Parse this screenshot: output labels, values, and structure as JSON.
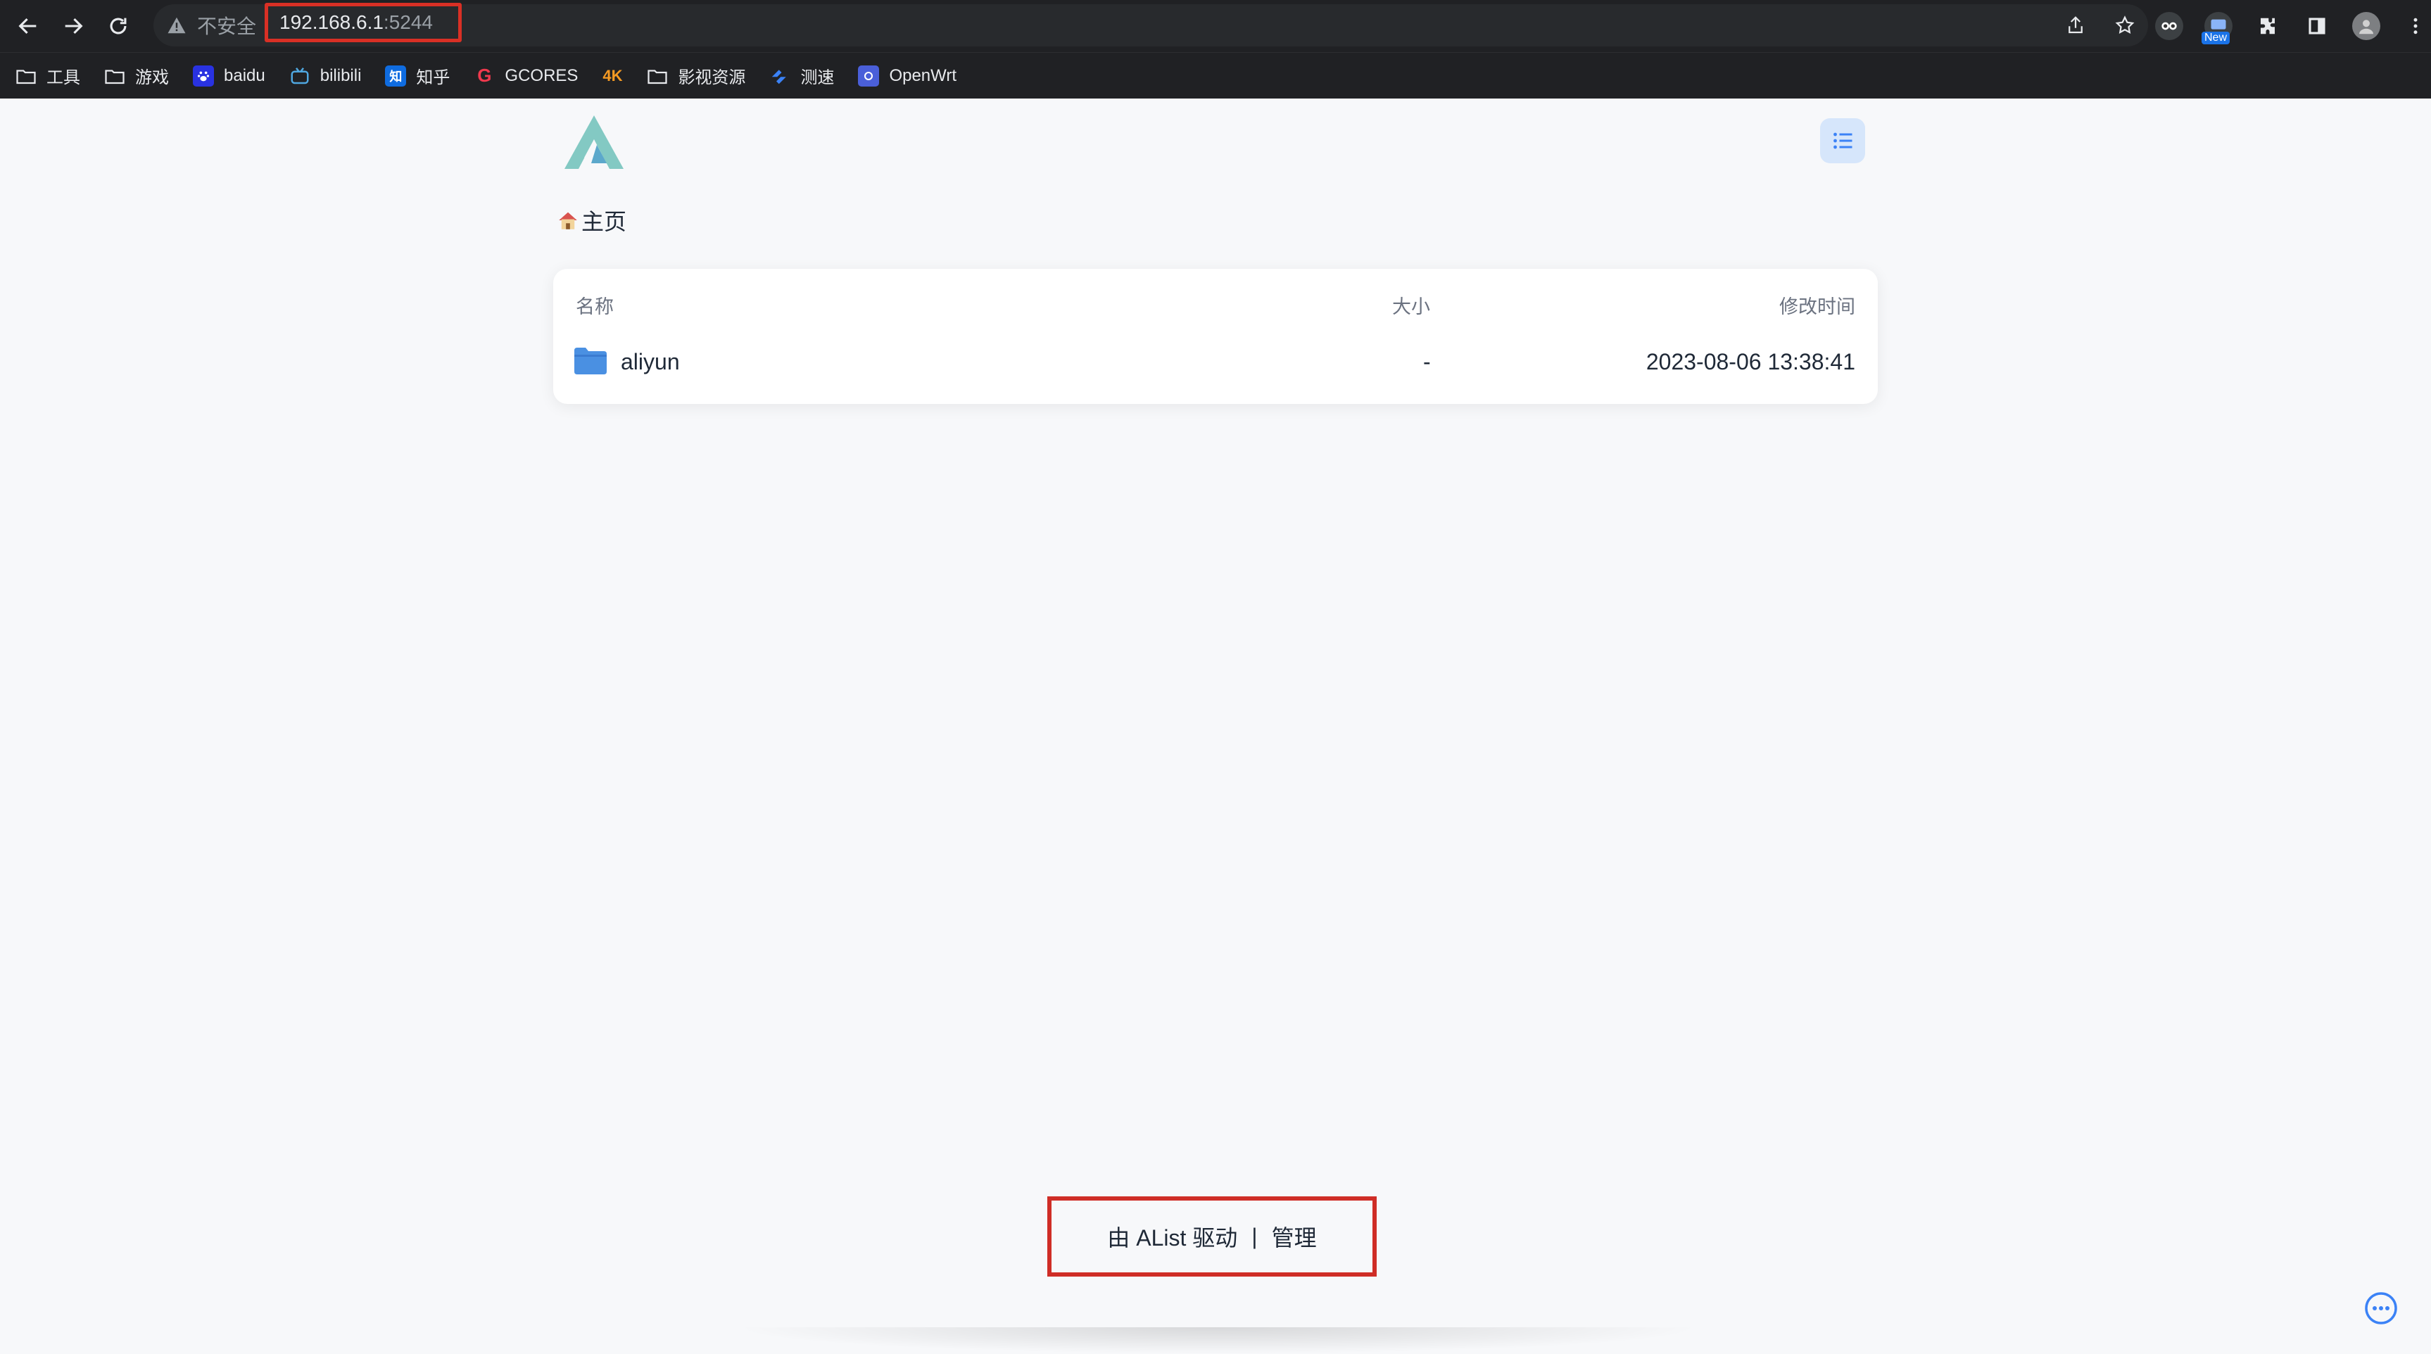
{
  "browser": {
    "insecure_label": "不安全",
    "url_host": "192.168.6.1",
    "url_port": ":5244",
    "new_badge": "New"
  },
  "bookmarks": [
    {
      "label": "工具",
      "icon": "folder-icon"
    },
    {
      "label": "游戏",
      "icon": "folder-icon"
    },
    {
      "label": "baidu",
      "icon": "baidu-paw-icon"
    },
    {
      "label": "bilibili",
      "icon": "bilibili-tv-icon"
    },
    {
      "label": "知乎",
      "icon": "zhihu-icon",
      "glyph": "知"
    },
    {
      "label": "GCORES",
      "icon": "gcores-icon",
      "glyph": "G"
    },
    {
      "label": "",
      "icon": "4k-icon",
      "glyph": "4K"
    },
    {
      "label": "影视资源",
      "icon": "folder-icon"
    },
    {
      "label": "测速",
      "icon": "speedtest-icon"
    },
    {
      "label": "OpenWrt",
      "icon": "openwrt-icon"
    }
  ],
  "page": {
    "breadcrumb_home": "主页",
    "table": {
      "headers": {
        "name": "名称",
        "size": "大小",
        "modified": "修改时间"
      },
      "rows": [
        {
          "name": "aliyun",
          "size": "-",
          "modified": "2023-08-06 13:38:41",
          "icon": "folder-icon"
        }
      ]
    },
    "footer": {
      "powered": "由 AList 驱动",
      "sep": "|",
      "manage": "管理"
    }
  },
  "colors": {
    "accent": "#4a90e2",
    "logo": "#6fc1b9",
    "highlight": "#d93025"
  }
}
